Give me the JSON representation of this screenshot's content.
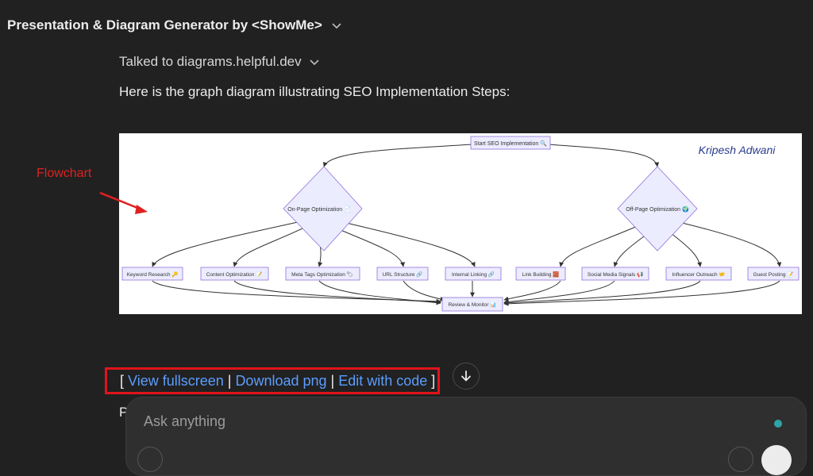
{
  "header": {
    "title": "Presentation & Diagram Generator by <ShowMe>"
  },
  "tool": {
    "label": "Talked to diagrams.helpful.dev"
  },
  "message": {
    "intro": "Here is the graph diagram illustrating SEO Implementation Steps:"
  },
  "annotation": {
    "label": "Flowchart",
    "color": "#e02020"
  },
  "diagram": {
    "signature": "Kripesh Adwani",
    "nodes": {
      "start": "Start SEO Implementation 🔍",
      "onpage": "On-Page Optimization 📄",
      "offpage": "Off-Page Optimization 🌍",
      "keyword": "Keyword Research 🔑",
      "content": "Content Optimization 📝",
      "meta": "Meta Tags Optimization 🏷",
      "url": "URL Structure 🔗",
      "internal": "Internal Linking 🔗",
      "link": "Link Building 🧱",
      "social": "Social Media Signals 📢",
      "influencer": "Influencer Outreach 🤝",
      "guest": "Guest Posting 📝",
      "review": "Review & Monitor 📊"
    },
    "colors": {
      "node_fill": "#ececff",
      "node_stroke": "#9370db",
      "edge": "#333333"
    }
  },
  "links": {
    "open": "[",
    "close": "]",
    "sep": "|",
    "view_fullscreen": "View fullscreen",
    "download_png": "Download png",
    "edit_with_code": "Edit with code",
    "link_color": "#5b9dff",
    "highlight_color": "#e0141a"
  },
  "truncated_text": "Pl",
  "composer": {
    "placeholder": "Ask anything"
  }
}
